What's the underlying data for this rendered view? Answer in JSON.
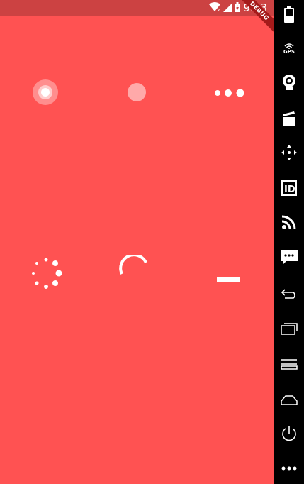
{
  "status_bar": {
    "time": "9:53",
    "debug_banner": "DEBUG",
    "icons": [
      "wifi-icon",
      "signal-icon",
      "battery-icon"
    ]
  },
  "spinners": [
    {
      "name": "ripple-spinner",
      "icon": "ripple"
    },
    {
      "name": "pulse-spinner",
      "icon": "pulse"
    },
    {
      "name": "three-bounce-spinner",
      "icon": "three-dots"
    },
    {
      "name": "fading-circle-spinner",
      "icon": "dotted-circle"
    },
    {
      "name": "arc-spinner",
      "icon": "arc"
    },
    {
      "name": "bar-spinner",
      "icon": "bar"
    }
  ],
  "colors": {
    "background": "#FF5252",
    "status_bar": "#CC4242",
    "sidebar": "#000000",
    "spinner": "#FFFFFF"
  },
  "emulator_sidebar": {
    "gps_label": "GPS",
    "id_label": "ID",
    "items": [
      "battery-icon",
      "gps-icon",
      "webcam-icon",
      "media-icon",
      "dpad-icon",
      "id-icon",
      "rss-icon",
      "message-icon",
      "back-icon",
      "recents-icon",
      "menu-icon",
      "home-icon",
      "power-icon",
      "more-icon"
    ]
  }
}
